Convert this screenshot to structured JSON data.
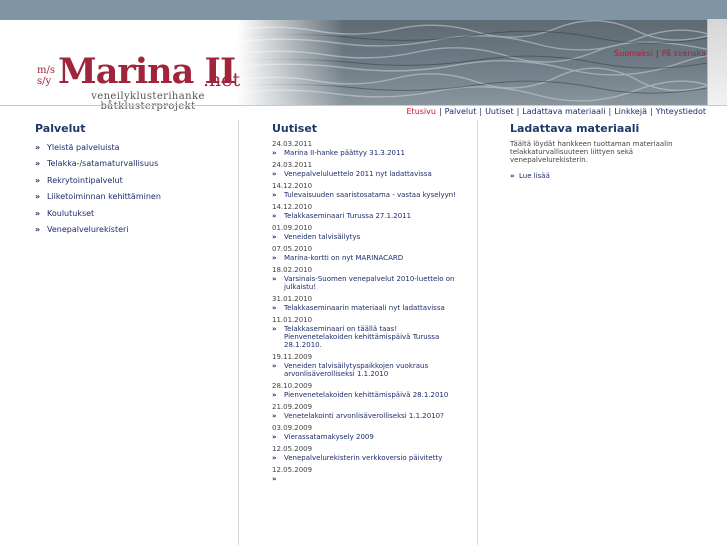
{
  "logo": {
    "ms": "m/s",
    "sy": "s/y",
    "name": "Marina II",
    "tld": ".net",
    "tagline_fi": "veneilyklusterihanke",
    "tagline_sv": "båtklusterprojekt"
  },
  "language": {
    "current": "Suomeksi",
    "other": "På svenska",
    "separator": "|"
  },
  "main_nav": {
    "items": [
      "Etusivu",
      "Palvelut",
      "Uutiset",
      "Ladattava materiaali",
      "Linkkejä",
      "Yhteystiedot"
    ],
    "active": "Etusivu",
    "separator": "|"
  },
  "services": {
    "title": "Palvelut",
    "items": [
      "Yleistä palveluista",
      "Telakka-/satamaturvallisuus",
      "Rekrytointipalvelut",
      "Liiketoiminnan kehittäminen",
      "Koulutukset",
      "Venepalvelurekisteri"
    ]
  },
  "news": {
    "title": "Uutiset",
    "items": [
      {
        "date": "24.03.2011",
        "title": "Marina II-hanke päättyy 31.3.2011"
      },
      {
        "date": "24.03.2011",
        "title": "Venepalveluluettelo 2011 nyt ladattavissa"
      },
      {
        "date": "14.12.2010",
        "title": "Tulevaisuuden saaristosatama - vastaa kyselyyn!"
      },
      {
        "date": "14.12.2010",
        "title": "Telakkaseminaari Turussa 27.1.2011"
      },
      {
        "date": "01.09.2010",
        "title": "Veneiden talvisäilytys"
      },
      {
        "date": "07.05.2010",
        "title": "Marina-kortti on nyt MARINACARD"
      },
      {
        "date": "18.02.2010",
        "title": "Varsinais-Suomen venepalvelut 2010-luettelo on julkaistu!"
      },
      {
        "date": "31.01.2010",
        "title": "Telakkaseminaarin materiaali nyt ladattavissa"
      },
      {
        "date": "11.01.2010",
        "title": "Telakkaseminaari on täällä taas! Pienvenetelakoiden kehittämispäivä Turussa 28.1.2010."
      },
      {
        "date": "19.11.2009",
        "title": "Veneiden talvisäilytyspaikkojen vuokraus arvonlisäverolliseksi 1.1.2010"
      },
      {
        "date": "28.10.2009",
        "title": "Pienvenetelakoiden kehittämispäivä 28.1.2010"
      },
      {
        "date": "21.09.2009",
        "title": "Venetelakointi arvonlisäverolliseksi 1.1.2010?"
      },
      {
        "date": "03.09.2009",
        "title": "Vierassatamakysely 2009"
      },
      {
        "date": "12.05.2009",
        "title": "Venepalvelurekisterin verkkoversio päivitetty"
      },
      {
        "date": "12.05.2009",
        "title": ""
      }
    ]
  },
  "downloads": {
    "title": "Ladattava materiaali",
    "text": "Täältä löydät hankkeen tuottaman materiaalin telakkaturvallisuuteen liittyen sekä venepalvelurekisterin.",
    "more": "Lue lisää"
  },
  "icons": {
    "list_arrow": "double-chevron-right-icon",
    "arrow_glyph": "»"
  },
  "colors": {
    "brand": "#a0243a",
    "link": "#1d2d6b",
    "heading": "#1d3a6b",
    "active": "#c8102e",
    "top_strip": "#7f95a4"
  }
}
